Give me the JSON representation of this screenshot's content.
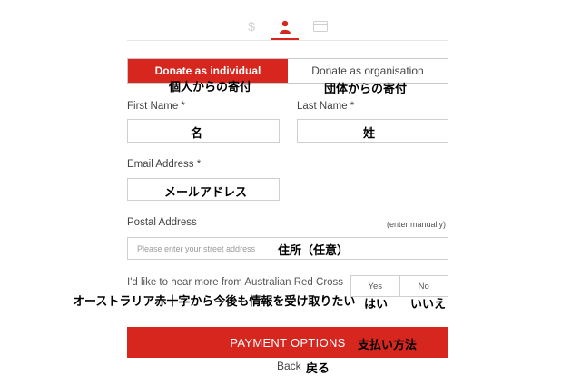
{
  "donor_type": {
    "individual_label": "Donate as individual",
    "individual_jp": "個人からの寄付",
    "organisation_label": "Donate as organisation",
    "organisation_jp": "団体からの寄付"
  },
  "fields": {
    "first_name": {
      "label": "First Name *",
      "value": "名"
    },
    "last_name": {
      "label": "Last Name *",
      "value": "姓"
    },
    "email": {
      "label": "Email Address *",
      "value": "メールアドレス"
    },
    "postal": {
      "label": "Postal Address",
      "enter_manually": "(enter manually)",
      "placeholder": "Please enter your street address",
      "jp": "住所（任意）"
    }
  },
  "opt_in": {
    "question": "I'd like to hear more from Australian Red Cross",
    "question_jp": "オーストラリア赤十字から今後も情報を受け取りたい",
    "yes": "Yes",
    "yes_jp": "はい",
    "no": "No",
    "no_jp": "いいえ"
  },
  "payment": {
    "label": "PAYMENT OPTIONS",
    "jp": "支払い方法"
  },
  "back": {
    "label": "Back",
    "jp": "戻る"
  },
  "steps": {
    "dollar": "$"
  },
  "colors": {
    "accent": "#d7261e",
    "border": "#cfcfcf"
  },
  "icons": [
    "dollar-icon",
    "person-icon",
    "card-icon"
  ]
}
